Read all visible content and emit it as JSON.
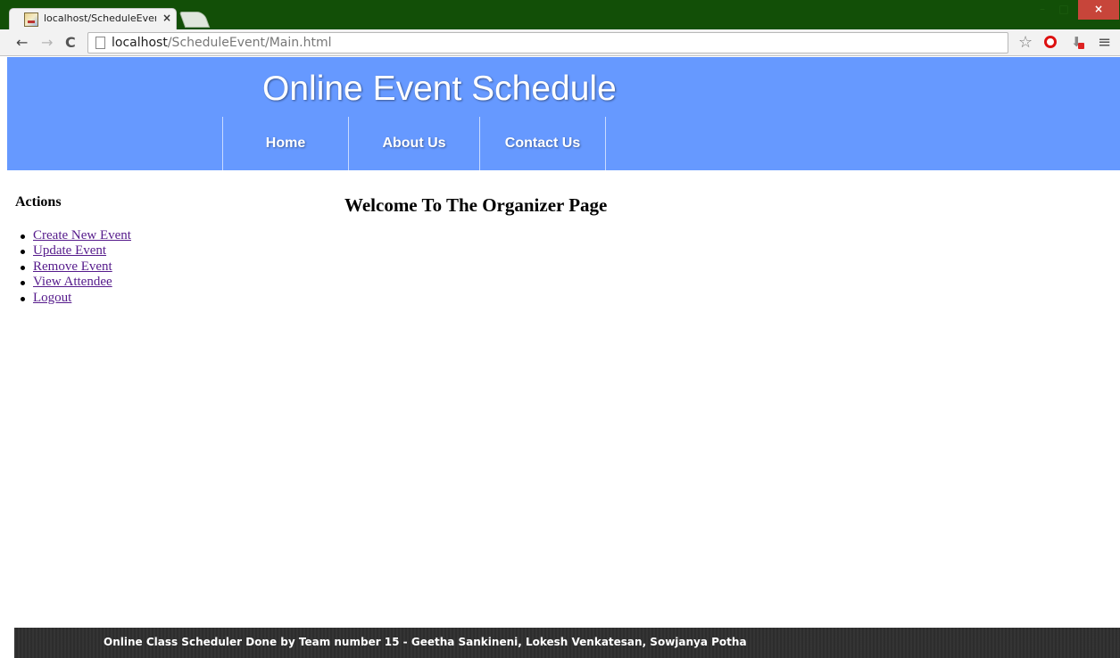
{
  "browser": {
    "tab_title": "localhost/ScheduleEvent/I",
    "tab_close": "×",
    "url_host": "localhost",
    "url_path": "/ScheduleEvent/Main.html",
    "window_close": "×",
    "window_min": "–",
    "window_max": "□"
  },
  "header": {
    "title": "Online Event Schedule",
    "nav": [
      {
        "label": "Home"
      },
      {
        "label": "About Us"
      },
      {
        "label": "Contact Us"
      }
    ]
  },
  "sidebar": {
    "heading": "Actions",
    "items": [
      {
        "label": "Create New Event"
      },
      {
        "label": "Update Event"
      },
      {
        "label": "Remove Event"
      },
      {
        "label": "View Attendee"
      },
      {
        "label": "Logout"
      }
    ]
  },
  "main": {
    "heading": "Welcome To The Organizer Page"
  },
  "footer": {
    "text": "Online Class Scheduler Done by Team number 15 - Geetha Sankineni, Lokesh Venkatesan, Sowjanya Potha"
  },
  "colors": {
    "header_bg": "#6699ff",
    "titlebar_bg": "#124f07",
    "link": "#551a8b",
    "footer_bg": "#2e2e2e"
  }
}
